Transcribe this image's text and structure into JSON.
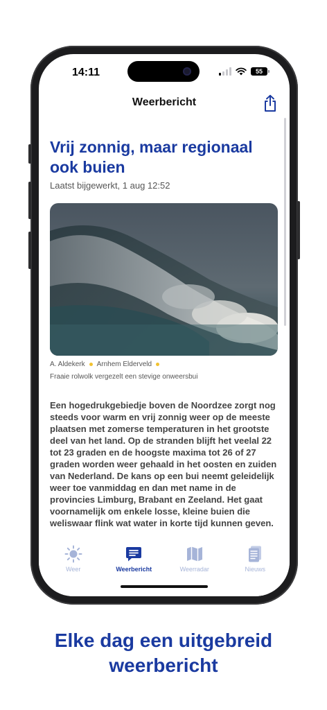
{
  "status": {
    "time": "14:11",
    "battery": "55"
  },
  "nav": {
    "title": "Weerbericht"
  },
  "article": {
    "headline": "Vrij zonnig, maar regionaal ook buien",
    "updated": "Laatst bijgewerkt, 1 aug 12:52",
    "credit_author": "A. Aldekerk",
    "credit_location": "Arnhem Elderveld",
    "caption": "Fraaie rolwolk vergezelt een stevige onweersbui",
    "body": "Een hogedrukgebiedje boven de Noordzee zorgt nog steeds voor warm en vrij zonnig weer op de meeste plaatsen met zomerse temperaturen in het grootste deel van het land. Op de stranden blijft het veelal 22 tot 23 graden en de hoogste maxima tot 26 of 27 graden worden weer gehaald in het oosten en zuiden van Nederland. De kans op een bui neemt geleidelijk weer toe vanmiddag en dan met name in de provincies Limburg, Brabant en Zeeland. Het gaat voornamelijk om enkele losse, kleine buien die weliswaar flink wat water in  korte tijd kunnen geven."
  },
  "tabs": [
    {
      "label": "Weer",
      "icon": "sun-icon",
      "active": false
    },
    {
      "label": "Weerbericht",
      "icon": "message-icon",
      "active": true
    },
    {
      "label": "Weerradar",
      "icon": "map-icon",
      "active": false
    },
    {
      "label": "Nieuws",
      "icon": "news-icon",
      "active": false
    }
  ],
  "promo": {
    "line1": "Elke dag een uitgebreid",
    "line2": "weerbericht"
  },
  "colors": {
    "accent": "#1a3aa0",
    "inactive_tab": "#a6b4d8",
    "credit_dot": "#f2c230"
  }
}
